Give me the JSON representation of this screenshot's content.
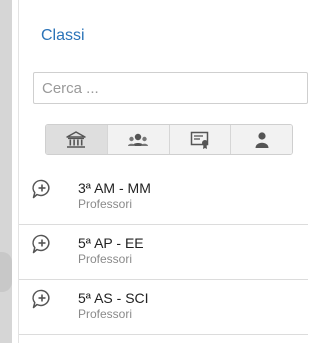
{
  "panel": {
    "title": "Classi"
  },
  "search": {
    "placeholder": "Cerca ..."
  },
  "tabs": [
    {
      "icon": "institution-icon",
      "active": true
    },
    {
      "icon": "group-icon",
      "active": false
    },
    {
      "icon": "certificate-icon",
      "active": false
    },
    {
      "icon": "user-icon",
      "active": false
    }
  ],
  "classes": [
    {
      "name": "3ª AM - MM",
      "subtitle": "Professori",
      "icon": "chat-add-icon"
    },
    {
      "name": "5ª AP - EE",
      "subtitle": "Professori",
      "icon": "chat-add-icon"
    },
    {
      "name": "5ª AS - SCI",
      "subtitle": "Professori",
      "icon": "chat-add-icon"
    }
  ],
  "colors": {
    "title": "#2a73b8",
    "icon": "#555555"
  }
}
